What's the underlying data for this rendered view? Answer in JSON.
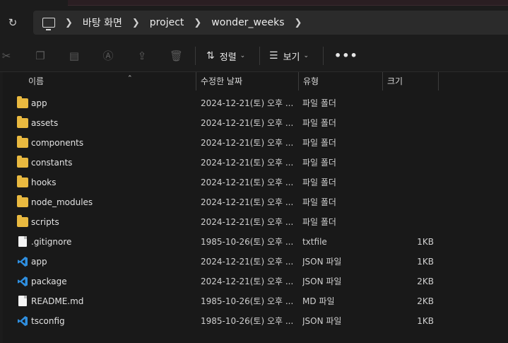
{
  "address": {
    "crumbs": [
      "바탕 화면",
      "project",
      "wonder_weeks"
    ]
  },
  "toolbar": {
    "sort_label": "정렬",
    "view_label": "보기",
    "more_label": "•••"
  },
  "columns": {
    "name": "이름",
    "date": "수정한 날짜",
    "type": "유형",
    "size": "크기"
  },
  "files": [
    {
      "icon": "folder-icon",
      "name": "app",
      "date": "2024-12-21(토) 오후 ...",
      "type": "파일 폴더",
      "size": ""
    },
    {
      "icon": "folder-icon",
      "name": "assets",
      "date": "2024-12-21(토) 오후 ...",
      "type": "파일 폴더",
      "size": ""
    },
    {
      "icon": "folder-icon",
      "name": "components",
      "date": "2024-12-21(토) 오후 ...",
      "type": "파일 폴더",
      "size": ""
    },
    {
      "icon": "folder-icon",
      "name": "constants",
      "date": "2024-12-21(토) 오후 ...",
      "type": "파일 폴더",
      "size": ""
    },
    {
      "icon": "folder-icon",
      "name": "hooks",
      "date": "2024-12-21(토) 오후 ...",
      "type": "파일 폴더",
      "size": ""
    },
    {
      "icon": "folder-icon",
      "name": "node_modules",
      "date": "2024-12-21(토) 오후 ...",
      "type": "파일 폴더",
      "size": ""
    },
    {
      "icon": "folder-icon",
      "name": "scripts",
      "date": "2024-12-21(토) 오후 ...",
      "type": "파일 폴더",
      "size": ""
    },
    {
      "icon": "file-icon",
      "name": ".gitignore",
      "date": "1985-10-26(토) 오후 ...",
      "type": "txtfile",
      "size": "1KB"
    },
    {
      "icon": "vscode-icon",
      "name": "app",
      "date": "2024-12-21(토) 오후 ...",
      "type": "JSON 파일",
      "size": "1KB"
    },
    {
      "icon": "vscode-icon",
      "name": "package",
      "date": "2024-12-21(토) 오후 ...",
      "type": "JSON 파일",
      "size": "2KB"
    },
    {
      "icon": "file-icon",
      "name": "README.md",
      "date": "1985-10-26(토) 오후 ...",
      "type": "MD 파일",
      "size": "2KB"
    },
    {
      "icon": "vscode-icon",
      "name": "tsconfig",
      "date": "1985-10-26(토) 오후 ...",
      "type": "JSON 파일",
      "size": "1KB"
    }
  ],
  "colors": {
    "background": "#191919",
    "folder": "#e9b940",
    "vscode": "#2f8fe0"
  }
}
